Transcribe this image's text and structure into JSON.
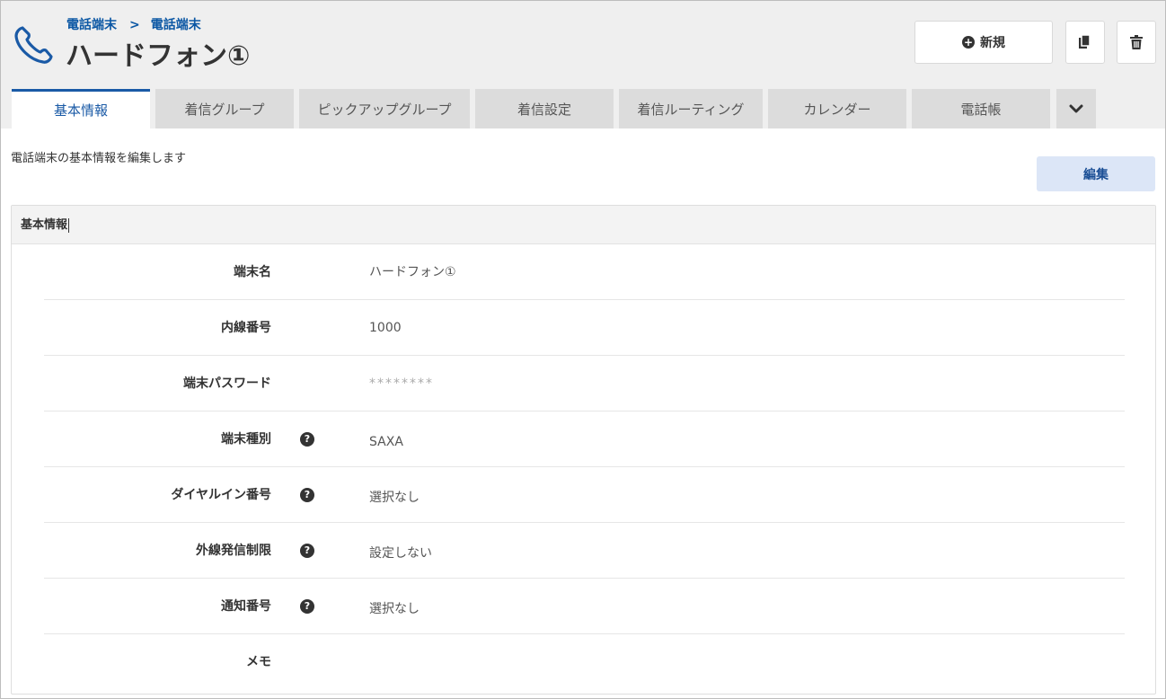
{
  "breadcrumb": {
    "items": [
      "電話端末",
      "電話端末"
    ],
    "separator": ">"
  },
  "page_title": "ハードフォン①",
  "toolbar": {
    "new_label": "新規",
    "new_icon": "plus-circle-icon",
    "copy_icon": "copy-icon",
    "delete_icon": "trash-icon"
  },
  "tabs": [
    {
      "label": "基本情報",
      "active": true
    },
    {
      "label": "着信グループ"
    },
    {
      "label": "ピックアップグループ"
    },
    {
      "label": "着信設定"
    },
    {
      "label": "着信ルーティング"
    },
    {
      "label": "カレンダー"
    },
    {
      "label": "電話帳"
    }
  ],
  "description": "電話端末の基本情報を編集します",
  "edit_label": "編集",
  "section": {
    "title": "基本情報",
    "fields": [
      {
        "label": "端末名",
        "value": "ハードフォン①",
        "help": false
      },
      {
        "label": "内線番号",
        "value": "1000",
        "help": false
      },
      {
        "label": "端末パスワード",
        "value": "********",
        "help": false
      },
      {
        "label": "端末種別",
        "value": "SAXA",
        "help": true
      },
      {
        "label": "ダイヤルイン番号",
        "value": "選択なし",
        "help": true
      },
      {
        "label": "外線発信制限",
        "value": "設定しない",
        "help": true
      },
      {
        "label": "通知番号",
        "value": "選択なし",
        "help": true
      },
      {
        "label": "メモ",
        "value": "",
        "help": false
      }
    ]
  },
  "help_glyph": "?",
  "colors": {
    "accent": "#1a5aa6",
    "breadcrumb": "#0b57a4",
    "edit_button_bg": "#dce6f7",
    "header_bg": "#efefef",
    "tab_bg": "#dcdcdc"
  }
}
